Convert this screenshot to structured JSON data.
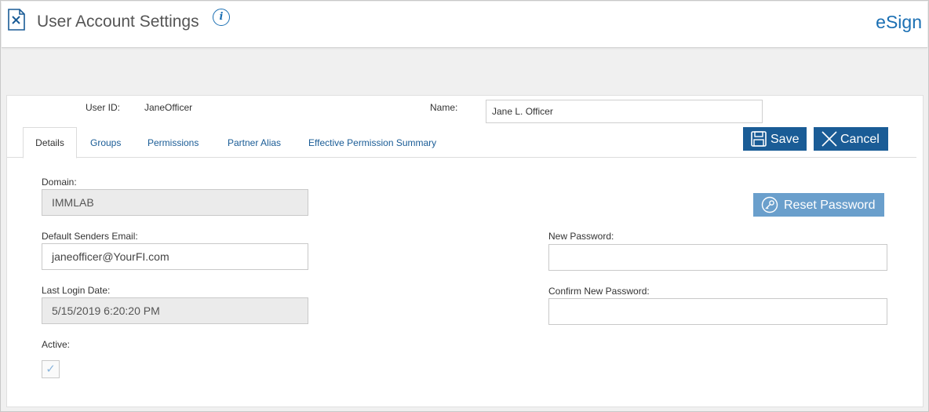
{
  "header": {
    "title": "User Account Settings",
    "info_icon": "info-icon",
    "brand": "eSign",
    "brand_color": "#1a6fb3"
  },
  "user": {
    "user_id_label": "User ID:",
    "user_id_value": "JaneOfficer",
    "name_label": "Name:",
    "name_value": "Jane L. Officer"
  },
  "tabs": [
    {
      "label": "Details",
      "active": true
    },
    {
      "label": "Groups",
      "active": false
    },
    {
      "label": "Permissions",
      "active": false
    },
    {
      "label": "Partner Alias",
      "active": false
    },
    {
      "label": "Effective Permission Summary",
      "active": false
    }
  ],
  "actions": {
    "save_label": "Save",
    "cancel_label": "Cancel",
    "reset_password_label": "Reset Password",
    "primary_color": "#1a5c96"
  },
  "details": {
    "domain_label": "Domain:",
    "domain_value": "IMMLAB",
    "email_label": "Default Senders Email:",
    "email_value": "janeofficer@YourFI.com",
    "last_login_label": "Last Login Date:",
    "last_login_value": "5/15/2019 6:20:20 PM",
    "active_label": "Active:",
    "active_checked": true,
    "checkmark": "✓",
    "new_password_label": "New Password:",
    "new_password_value": "",
    "confirm_password_label": "Confirm New Password:",
    "confirm_password_value": ""
  }
}
